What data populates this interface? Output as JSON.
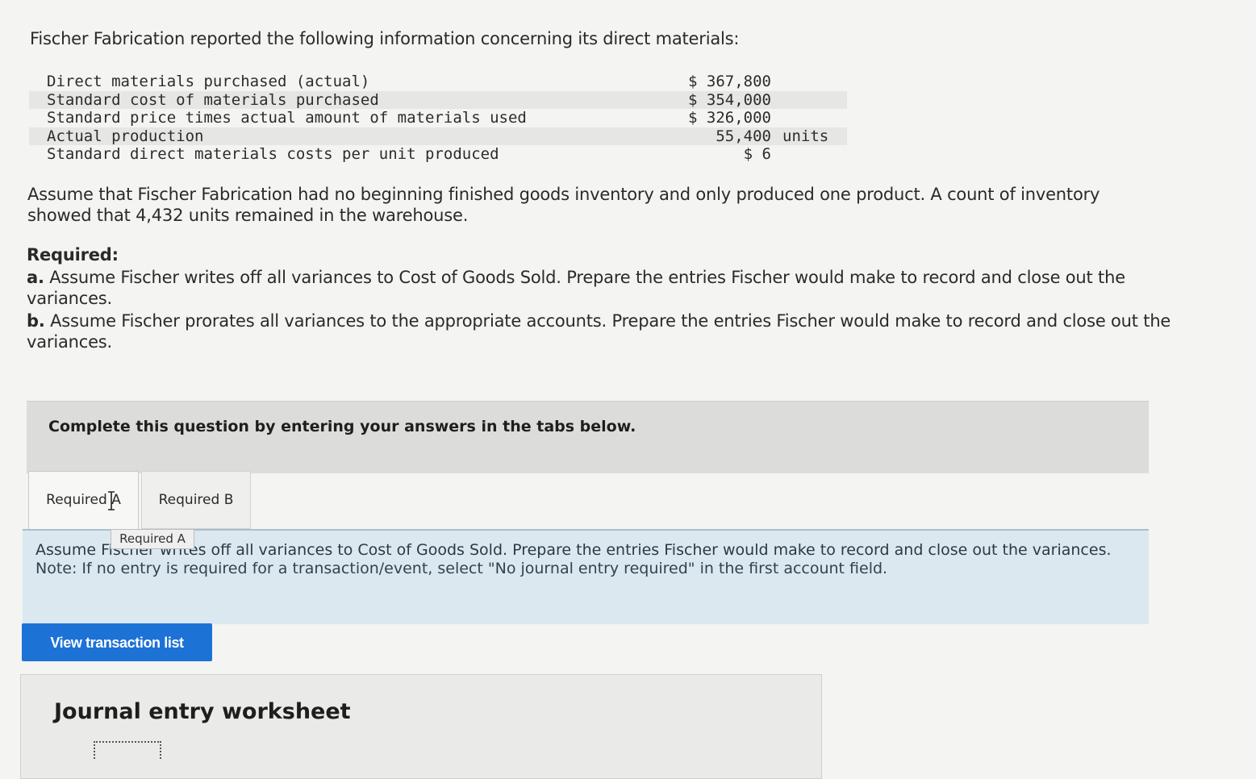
{
  "intro": "Fischer Fabrication reported the following information concerning its direct materials:",
  "materials": [
    {
      "label": "Direct materials purchased (actual)",
      "value": "$ 367,800",
      "unit": ""
    },
    {
      "label": "Standard cost of materials purchased",
      "value": "$ 354,000",
      "unit": ""
    },
    {
      "label": "Standard price times actual amount of materials used",
      "value": "$ 326,000",
      "unit": ""
    },
    {
      "label": "Actual production",
      "value": "55,400",
      "unit": "units"
    },
    {
      "label": "Standard direct materials costs per unit produced",
      "value": "$ 6",
      "unit": ""
    }
  ],
  "assumption": "Assume that Fischer Fabrication had no beginning finished goods inventory and only produced one product. A count of inventory showed that 4,432 units remained in the warehouse.",
  "required": {
    "heading": "Required:",
    "a_prefix": "a.",
    "a_text": " Assume Fischer writes off all variances to Cost of Goods Sold. Prepare the entries Fischer would make to record and close out the variances.",
    "b_prefix": "b.",
    "b_text": " Assume Fischer prorates all variances to the appropriate accounts. Prepare the entries Fischer would make to record and close out the variances."
  },
  "complete_text": "Complete this question by entering your answers in the tabs below.",
  "tabs": [
    {
      "label": "Required A"
    },
    {
      "label": "Required B"
    }
  ],
  "tooltip": "Required A",
  "instruction": {
    "text": "Assume Fischer writes off all variances to Cost of Goods Sold. Prepare the entries Fischer would make to record and close out the variances.",
    "note": "Note: If no entry is required for a transaction/event, select \"No journal entry required\" in the first account field."
  },
  "view_button": "View transaction list",
  "worksheet_title": "Journal entry worksheet",
  "colors": {
    "button": "#1d72d6",
    "instruction_bg": "#dce8ef",
    "banner_bg": "#dcdcda"
  }
}
